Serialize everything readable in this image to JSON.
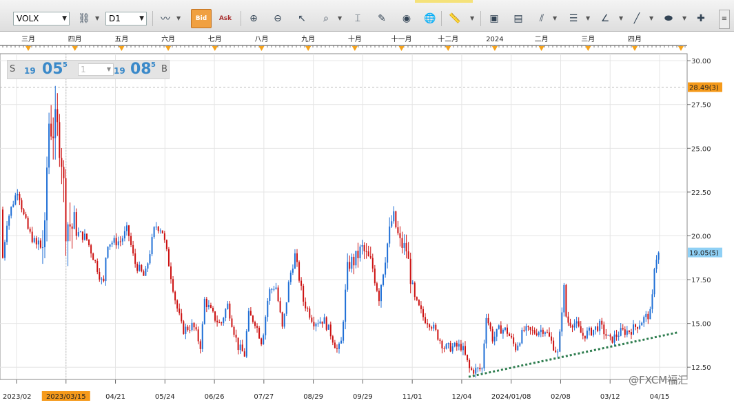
{
  "toolbar": {
    "symbol": "VOLX",
    "timeframe": "D1",
    "bid_label": "Bid",
    "ask_label": "Ask",
    "scroll_glyph": "≡"
  },
  "quote": {
    "sell_label": "S",
    "sell_small": "19",
    "sell_big": "05",
    "sell_sup": "5",
    "qty": "1",
    "buy_small": "19",
    "buy_big": "08",
    "buy_sup": "5",
    "buy_label": "B"
  },
  "watermark": "@FXCM福汇",
  "colors": {
    "up": "#1f6fd6",
    "down": "#cc1111",
    "trend": "#2e7d4f",
    "ask_badge": "#f59a1b",
    "bid_badge": "#8fd0f5"
  },
  "chart_data": {
    "type": "candlestick",
    "y_ticks": [
      "30.00",
      "27.50",
      "25.00",
      "22.50",
      "20.00",
      "17.50",
      "15.00",
      "12.50"
    ],
    "ylim": [
      11.8,
      30.4
    ],
    "months_top": [
      "三月",
      "四月",
      "五月",
      "六月",
      "七月",
      "八月",
      "九月",
      "十月",
      "十一月",
      "十二月",
      "2024",
      "二月",
      "三月",
      "四月"
    ],
    "x_labels": [
      "2023/02",
      "2023/03/15",
      "04/21",
      "05/24",
      "06/26",
      "07/27",
      "08/29",
      "09/29",
      "11/01",
      "12/04",
      "2024/01/08",
      "02/08",
      "03/12",
      "04/15"
    ],
    "ask_badge": "28.49(3)",
    "ask_value": 28.49,
    "bid_badge": "19.05(5)",
    "bid_value": 19.05,
    "anchors": [
      [
        0,
        21.5
      ],
      [
        3,
        18.4
      ],
      [
        10,
        20.8
      ],
      [
        18,
        21.8
      ],
      [
        26,
        22.7
      ],
      [
        34,
        21.2
      ],
      [
        42,
        20.2
      ],
      [
        55,
        19.3
      ],
      [
        65,
        19.7
      ],
      [
        70,
        26.6
      ],
      [
        75,
        26.3
      ],
      [
        88,
        25.6
      ],
      [
        95,
        21.0
      ],
      [
        110,
        20.2
      ],
      [
        125,
        19.9
      ],
      [
        140,
        18.3
      ],
      [
        150,
        17.1
      ],
      [
        155,
        19.6
      ],
      [
        175,
        19.7
      ],
      [
        185,
        20.4
      ],
      [
        195,
        18.5
      ],
      [
        210,
        17.6
      ],
      [
        225,
        20.6
      ],
      [
        235,
        20.4
      ],
      [
        245,
        18.4
      ],
      [
        255,
        16.2
      ],
      [
        265,
        14.6
      ],
      [
        280,
        14.9
      ],
      [
        292,
        13.6
      ],
      [
        296,
        16.4
      ],
      [
        310,
        15.4
      ],
      [
        320,
        14.9
      ],
      [
        330,
        16.1
      ],
      [
        345,
        13.7
      ],
      [
        355,
        13.2
      ],
      [
        360,
        15.5
      ],
      [
        370,
        15.1
      ],
      [
        380,
        13.9
      ],
      [
        390,
        16.8
      ],
      [
        400,
        17.2
      ],
      [
        410,
        14.6
      ],
      [
        420,
        17.6
      ],
      [
        428,
        18.9
      ],
      [
        440,
        16.3
      ],
      [
        455,
        15.1
      ],
      [
        470,
        15.2
      ],
      [
        480,
        14.4
      ],
      [
        490,
        13.4
      ],
      [
        495,
        13.9
      ],
      [
        505,
        18.4
      ],
      [
        515,
        18.6
      ],
      [
        525,
        19.3
      ],
      [
        540,
        18.3
      ],
      [
        550,
        16.6
      ],
      [
        560,
        19.1
      ],
      [
        570,
        21.2
      ],
      [
        580,
        19.6
      ],
      [
        590,
        19.2
      ],
      [
        600,
        16.5
      ],
      [
        615,
        15.3
      ],
      [
        625,
        15.0
      ],
      [
        645,
        13.6
      ],
      [
        670,
        13.7
      ],
      [
        682,
        12.3
      ],
      [
        700,
        12.4
      ],
      [
        705,
        15.6
      ],
      [
        715,
        14.1
      ],
      [
        725,
        14.7
      ],
      [
        735,
        14.6
      ],
      [
        748,
        13.6
      ],
      [
        760,
        14.6
      ],
      [
        775,
        14.5
      ],
      [
        790,
        14.7
      ],
      [
        810,
        13.2
      ],
      [
        818,
        17.2
      ],
      [
        822,
        15.1
      ],
      [
        835,
        15.0
      ],
      [
        845,
        14.3
      ],
      [
        860,
        14.6
      ],
      [
        870,
        14.9
      ],
      [
        885,
        14.0
      ],
      [
        900,
        14.5
      ],
      [
        915,
        14.6
      ],
      [
        925,
        14.9
      ],
      [
        935,
        15.3
      ],
      [
        945,
        15.6
      ],
      [
        950,
        18.6
      ],
      [
        956,
        19.0
      ]
    ],
    "trendline": [
      [
        680,
        11.95
      ],
      [
        985,
        14.5
      ]
    ]
  }
}
